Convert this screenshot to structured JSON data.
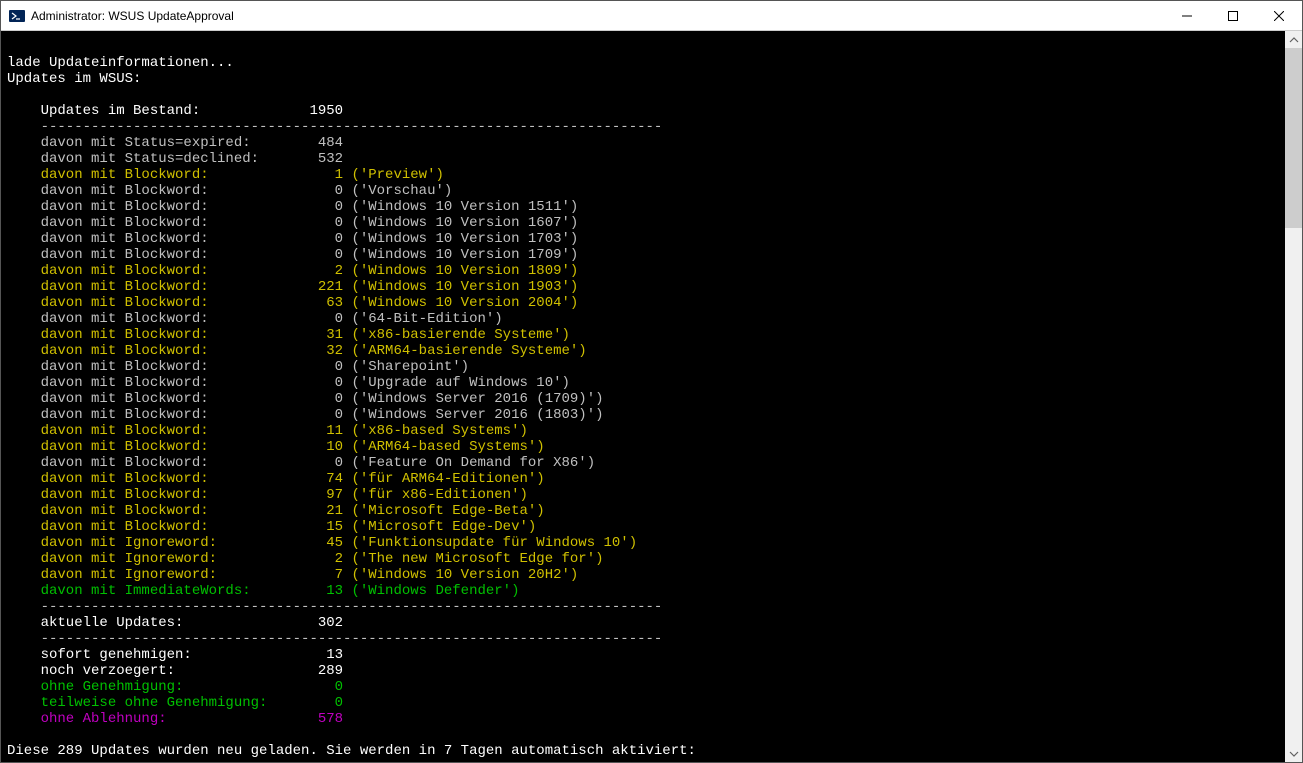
{
  "window": {
    "title": "Administrator: WSUS UpdateApproval"
  },
  "intro": {
    "loading": "lade Updateinformationen...",
    "header": "Updates im WSUS:"
  },
  "divider": "    --------------------------------------------------------------------------",
  "totals": {
    "bestand_label": "    Updates im Bestand:",
    "bestand_value": "1950",
    "expired_label": "    davon mit Status=expired:",
    "expired_value": "484",
    "declined_label": "    davon mit Status=declined:",
    "declined_value": "532"
  },
  "blockwords": [
    {
      "count": "1",
      "word": "Preview",
      "color": "yellow"
    },
    {
      "count": "0",
      "word": "Vorschau",
      "color": "gray"
    },
    {
      "count": "0",
      "word": "Windows 10 Version 1511",
      "color": "gray"
    },
    {
      "count": "0",
      "word": "Windows 10 Version 1607",
      "color": "gray"
    },
    {
      "count": "0",
      "word": "Windows 10 Version 1703",
      "color": "gray"
    },
    {
      "count": "0",
      "word": "Windows 10 Version 1709",
      "color": "gray"
    },
    {
      "count": "2",
      "word": "Windows 10 Version 1809",
      "color": "yellow"
    },
    {
      "count": "221",
      "word": "Windows 10 Version 1903",
      "color": "yellow"
    },
    {
      "count": "63",
      "word": "Windows 10 Version 2004",
      "color": "yellow"
    },
    {
      "count": "0",
      "word": "64-Bit-Edition",
      "color": "gray"
    },
    {
      "count": "31",
      "word": "x86-basierende Systeme",
      "color": "yellow"
    },
    {
      "count": "32",
      "word": "ARM64-basierende Systeme",
      "color": "yellow"
    },
    {
      "count": "0",
      "word": "Sharepoint",
      "color": "gray"
    },
    {
      "count": "0",
      "word": "Upgrade auf Windows 10",
      "color": "gray"
    },
    {
      "count": "0",
      "word": "Windows Server 2016 (1709)",
      "color": "gray"
    },
    {
      "count": "0",
      "word": "Windows Server 2016 (1803)",
      "color": "gray"
    },
    {
      "count": "11",
      "word": "x86-based Systems",
      "color": "yellow"
    },
    {
      "count": "10",
      "word": "ARM64-based Systems",
      "color": "yellow"
    },
    {
      "count": "0",
      "word": "Feature On Demand for X86",
      "color": "gray"
    },
    {
      "count": "74",
      "word": "für ARM64-Editionen",
      "color": "yellow"
    },
    {
      "count": "97",
      "word": "für x86-Editionen",
      "color": "yellow"
    },
    {
      "count": "21",
      "word": "Microsoft Edge-Beta",
      "color": "yellow"
    },
    {
      "count": "15",
      "word": "Microsoft Edge-Dev",
      "color": "yellow"
    }
  ],
  "ignorewords": [
    {
      "count": "45",
      "word": "Funktionsupdate für Windows 10",
      "color": "yellow"
    },
    {
      "count": "2",
      "word": "The new Microsoft Edge for",
      "color": "yellow"
    },
    {
      "count": "7",
      "word": "Windows 10 Version 20H2",
      "color": "yellow"
    }
  ],
  "immediatewords": [
    {
      "count": "13",
      "word": "Windows Defender",
      "color": "green"
    }
  ],
  "labels": {
    "blockword": "    davon mit Blockword:",
    "ignoreword": "    davon mit Ignoreword:",
    "immediatewords": "    davon mit ImmediateWords:"
  },
  "summary": {
    "aktuelle_label": "    aktuelle Updates:",
    "aktuelle_value": "302",
    "sofort_label": "    sofort genehmigen:",
    "sofort_value": "13",
    "verzoegert_label": "    noch verzoegert:",
    "verzoegert_value": "289",
    "ohne_gen_label": "    ohne Genehmigung:",
    "ohne_gen_value": "0",
    "teilw_label": "    teilweise ohne Genehmigung:",
    "teilw_value": "0",
    "ohne_abl_label": "    ohne Ablehnung:",
    "ohne_abl_value": "578"
  },
  "footer": "Diese 289 Updates wurden neu geladen. Sie werden in 7 Tagen automatisch aktiviert:"
}
